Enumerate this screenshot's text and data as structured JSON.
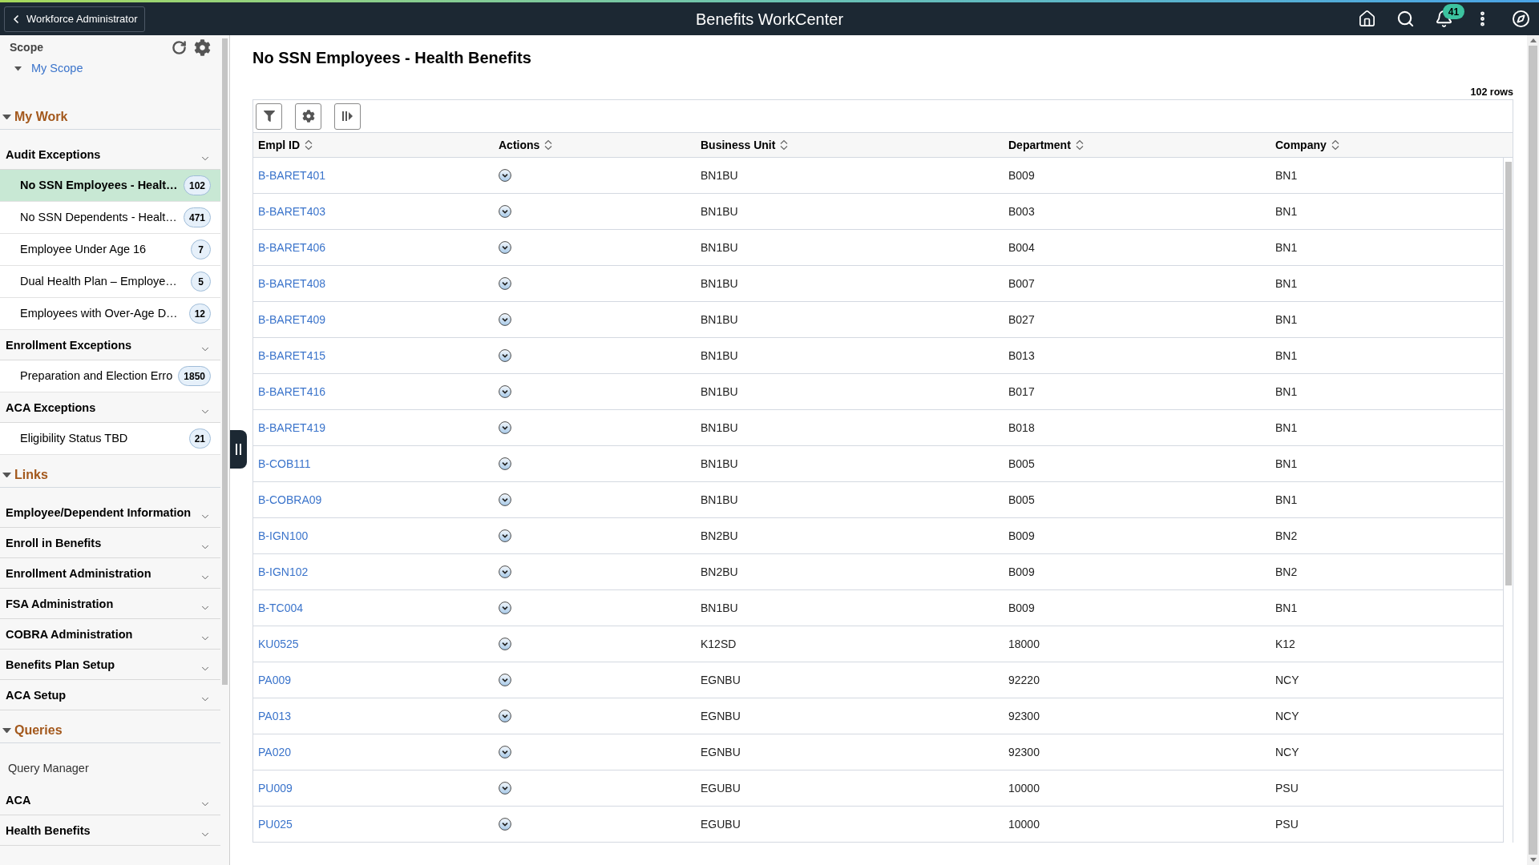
{
  "header": {
    "back_button": "Workforce Administrator",
    "title": "Benefits WorkCenter",
    "notification_count": "41"
  },
  "sidebar": {
    "scope": {
      "label": "Scope",
      "items": [
        {
          "label": "My Scope",
          "expanded": true
        }
      ]
    },
    "sections": [
      {
        "title": "My Work",
        "expanded": true,
        "entries": [
          {
            "kind": "group",
            "label": "Audit Exceptions",
            "items": [
              {
                "label": "No SSN Employees - Healt…",
                "count": "102",
                "selected": true
              },
              {
                "label": "No SSN Dependents - Healt…",
                "count": "471",
                "selected": false
              },
              {
                "label": "Employee Under Age 16",
                "count": "7",
                "selected": false
              },
              {
                "label": "Dual Health Plan – Employe…",
                "count": "5",
                "selected": false
              },
              {
                "label": "Employees with Over-Age D…",
                "count": "12",
                "selected": false
              }
            ]
          },
          {
            "kind": "group",
            "label": "Enrollment Exceptions",
            "items": [
              {
                "label": "Preparation and Election Erro",
                "count": "1850",
                "selected": false
              }
            ]
          },
          {
            "kind": "group",
            "label": "ACA Exceptions",
            "items": [
              {
                "label": "Eligibility Status TBD",
                "count": "21",
                "selected": false
              }
            ]
          }
        ]
      },
      {
        "title": "Links",
        "expanded": true,
        "entries": [
          {
            "kind": "group",
            "label": "Employee/Dependent Information"
          },
          {
            "kind": "group",
            "label": "Enroll in Benefits"
          },
          {
            "kind": "group",
            "label": "Enrollment Administration"
          },
          {
            "kind": "group",
            "label": "FSA Administration"
          },
          {
            "kind": "group",
            "label": "COBRA Administration"
          },
          {
            "kind": "group",
            "label": "Benefits Plan Setup"
          },
          {
            "kind": "group",
            "label": "ACA Setup"
          }
        ]
      },
      {
        "title": "Queries",
        "expanded": true,
        "entries": [
          {
            "kind": "link",
            "label": "Query Manager"
          },
          {
            "kind": "group",
            "label": "ACA"
          },
          {
            "kind": "group",
            "label": "Health Benefits"
          }
        ]
      }
    ]
  },
  "main": {
    "title": "No SSN Employees - Health Benefits",
    "row_count": "102 rows",
    "table": {
      "columns": [
        "Empl ID",
        "Actions",
        "Business Unit",
        "Department",
        "Company"
      ],
      "rows": [
        {
          "empl_id": "B-BARET401",
          "business_unit": "BN1BU",
          "department": "B009",
          "company": "BN1"
        },
        {
          "empl_id": "B-BARET403",
          "business_unit": "BN1BU",
          "department": "B003",
          "company": "BN1"
        },
        {
          "empl_id": "B-BARET406",
          "business_unit": "BN1BU",
          "department": "B004",
          "company": "BN1"
        },
        {
          "empl_id": "B-BARET408",
          "business_unit": "BN1BU",
          "department": "B007",
          "company": "BN1"
        },
        {
          "empl_id": "B-BARET409",
          "business_unit": "BN1BU",
          "department": "B027",
          "company": "BN1"
        },
        {
          "empl_id": "B-BARET415",
          "business_unit": "BN1BU",
          "department": "B013",
          "company": "BN1"
        },
        {
          "empl_id": "B-BARET416",
          "business_unit": "BN1BU",
          "department": "B017",
          "company": "BN1"
        },
        {
          "empl_id": "B-BARET419",
          "business_unit": "BN1BU",
          "department": "B018",
          "company": "BN1"
        },
        {
          "empl_id": "B-COB111",
          "business_unit": "BN1BU",
          "department": "B005",
          "company": "BN1"
        },
        {
          "empl_id": "B-COBRA09",
          "business_unit": "BN1BU",
          "department": "B005",
          "company": "BN1"
        },
        {
          "empl_id": "B-IGN100",
          "business_unit": "BN2BU",
          "department": "B009",
          "company": "BN2"
        },
        {
          "empl_id": "B-IGN102",
          "business_unit": "BN2BU",
          "department": "B009",
          "company": "BN2"
        },
        {
          "empl_id": "B-TC004",
          "business_unit": "BN1BU",
          "department": "B009",
          "company": "BN1"
        },
        {
          "empl_id": "KU0525",
          "business_unit": "K12SD",
          "department": "18000",
          "company": "K12"
        },
        {
          "empl_id": "PA009",
          "business_unit": "EGNBU",
          "department": "92220",
          "company": "NCY"
        },
        {
          "empl_id": "PA013",
          "business_unit": "EGNBU",
          "department": "92300",
          "company": "NCY"
        },
        {
          "empl_id": "PA020",
          "business_unit": "EGNBU",
          "department": "92300",
          "company": "NCY"
        },
        {
          "empl_id": "PU009",
          "business_unit": "EGUBU",
          "department": "10000",
          "company": "PSU"
        },
        {
          "empl_id": "PU025",
          "business_unit": "EGUBU",
          "department": "10000",
          "company": "PSU"
        }
      ]
    }
  }
}
